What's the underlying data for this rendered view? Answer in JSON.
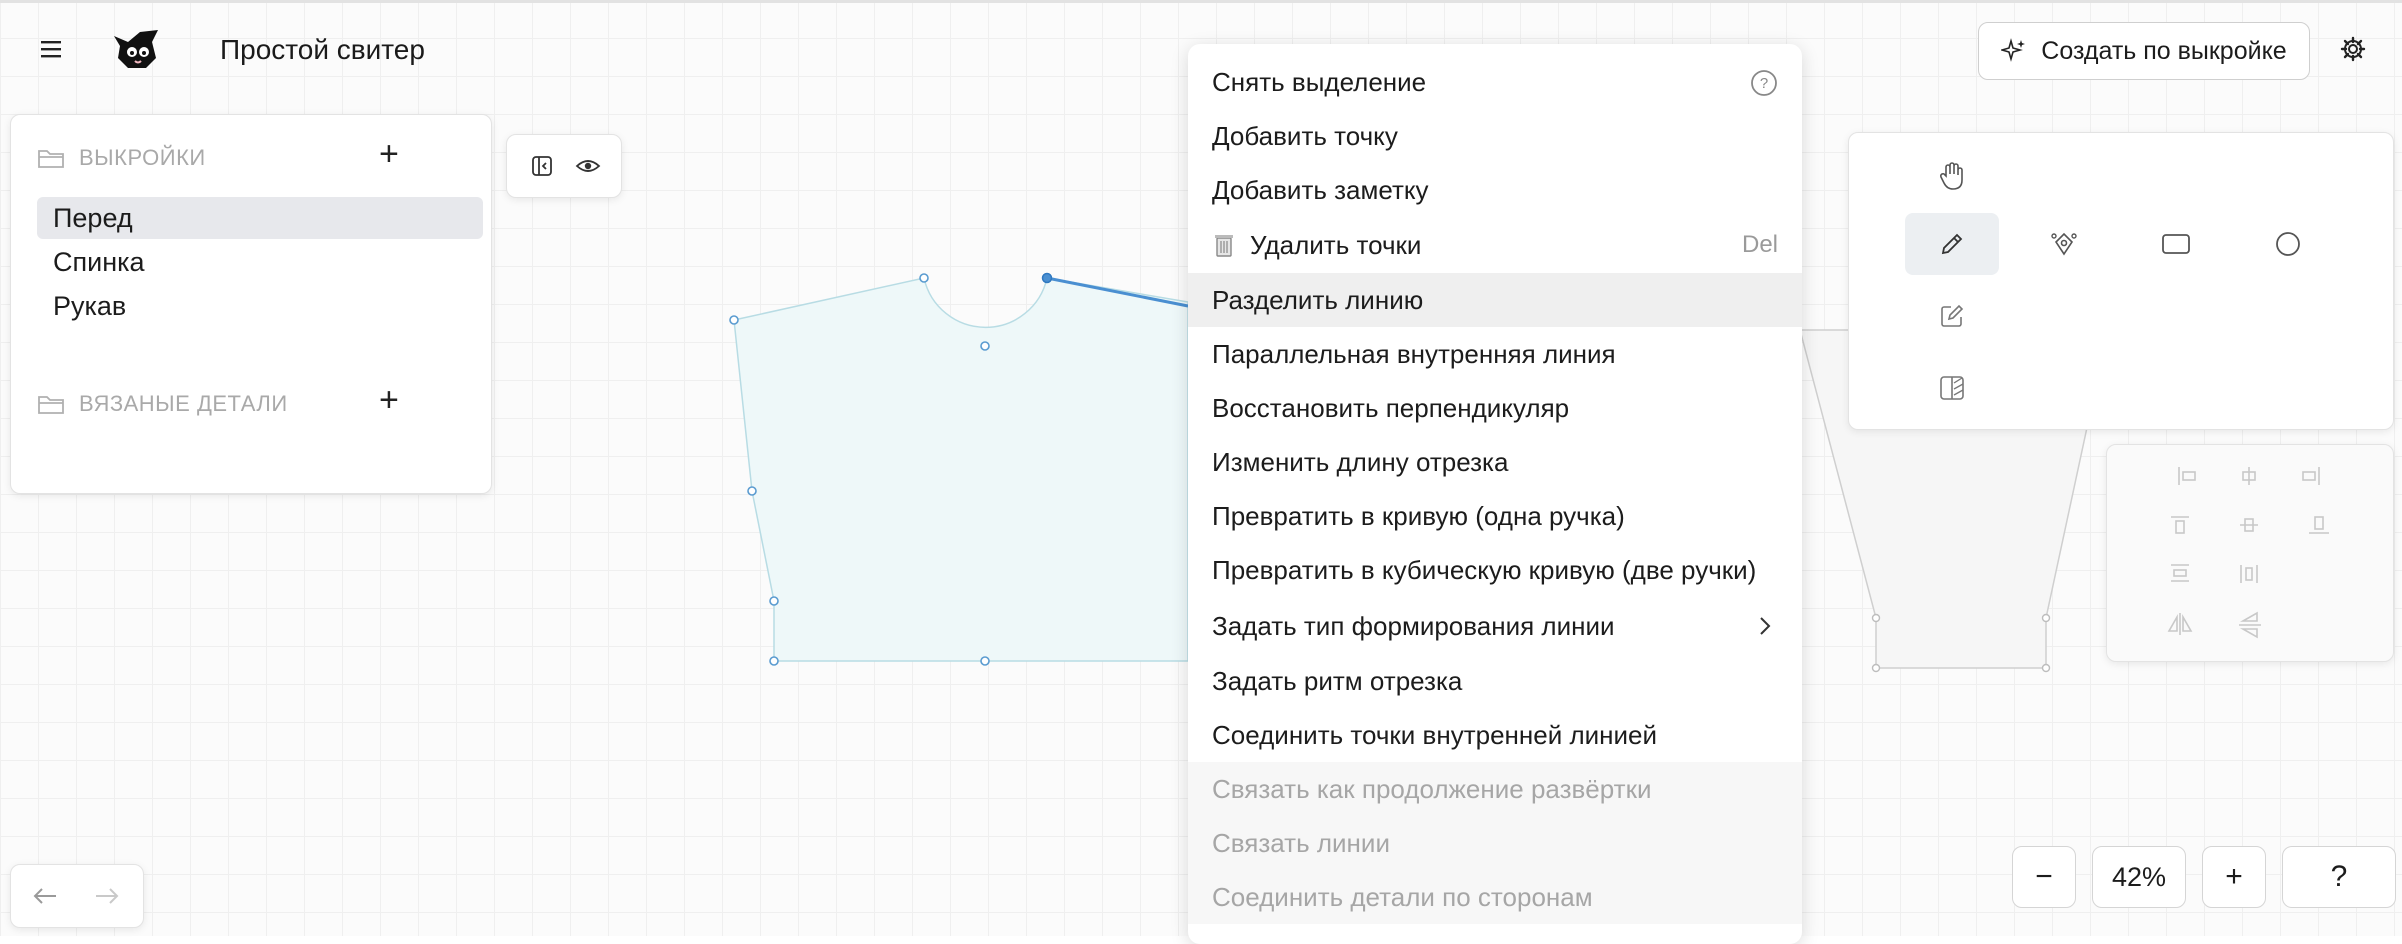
{
  "app": {
    "title": "Простой свитер"
  },
  "icons": {
    "menu": "hamburger-menu-icon",
    "logo": "cat-logo-icon",
    "settings": "gear-icon"
  },
  "sidebar": {
    "patterns_header": "ВЫКРОЙКИ",
    "patterns": [
      {
        "label": "Перед",
        "selected": true
      },
      {
        "label": "Спинка",
        "selected": false
      },
      {
        "label": "Рукав",
        "selected": false
      }
    ],
    "knit_header": "ВЯЗАНЫЕ ДЕТАЛИ",
    "add_symbol": "+"
  },
  "context_menu": {
    "items": [
      {
        "label": "Снять выделение",
        "state": "normal",
        "extra": "help-icon"
      },
      {
        "label": "Добавить точку",
        "state": "normal"
      },
      {
        "label": "Добавить заметку",
        "state": "normal"
      },
      {
        "label": "Удалить точки",
        "state": "normal",
        "shortcut": "Del",
        "icon": "trash-icon"
      },
      {
        "label": "Разделить линию",
        "state": "highlighted"
      },
      {
        "label": "Параллельная внутренняя линия",
        "state": "normal"
      },
      {
        "label": "Восстановить перпендикуляр",
        "state": "normal"
      },
      {
        "label": "Изменить длину отрезка",
        "state": "normal"
      },
      {
        "label": "Превратить в кривую (одна ручка)",
        "state": "normal"
      },
      {
        "label": "Превратить в кубическую кривую (две ручки)",
        "state": "normal"
      },
      {
        "label": "Задать тип формирования линии",
        "state": "normal",
        "submenu": true
      },
      {
        "label": "Задать ритм отрезка",
        "state": "normal"
      },
      {
        "label": "Соединить точки внутренней линией",
        "state": "normal"
      },
      {
        "label": "Связать как продолжение развёртки",
        "state": "disabled"
      },
      {
        "label": "Связать линии",
        "state": "disabled"
      },
      {
        "label": "Соединить детали по сторонам",
        "state": "disabled"
      }
    ]
  },
  "header_actions": {
    "create_label": "Создать по выкройке"
  },
  "tools": [
    "hand-icon",
    "pencil-icon",
    "pen-node-icon",
    "rectangle-icon",
    "circle-icon",
    "edit-icon",
    "fill-pattern-icon"
  ],
  "zoom": {
    "level": "42%",
    "minus": "−",
    "plus": "+",
    "help": "?"
  },
  "colors": {
    "accent": "#4a8fd1",
    "shape_fill": "#eef8f9",
    "selection_bg": "#e7e8ec"
  }
}
